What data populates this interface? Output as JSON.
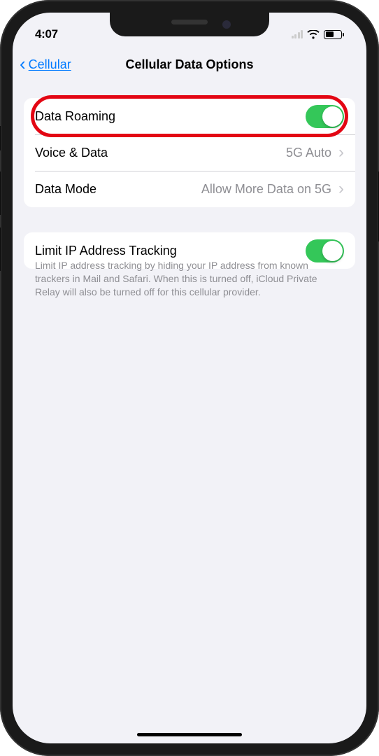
{
  "statusBar": {
    "time": "4:07"
  },
  "nav": {
    "back_label": "Cellular",
    "title": "Cellular Data Options"
  },
  "group1": {
    "rows": [
      {
        "label": "Data Roaming",
        "toggle": true
      },
      {
        "label": "Voice & Data",
        "value": "5G Auto"
      },
      {
        "label": "Data Mode",
        "value": "Allow More Data on 5G"
      }
    ]
  },
  "group2": {
    "rows": [
      {
        "label": "Limit IP Address Tracking",
        "toggle": true
      }
    ],
    "footer": "Limit IP address tracking by hiding your IP address from known trackers in Mail and Safari. When this is turned off, iCloud Private Relay will also be turned off for this cellular provider."
  }
}
